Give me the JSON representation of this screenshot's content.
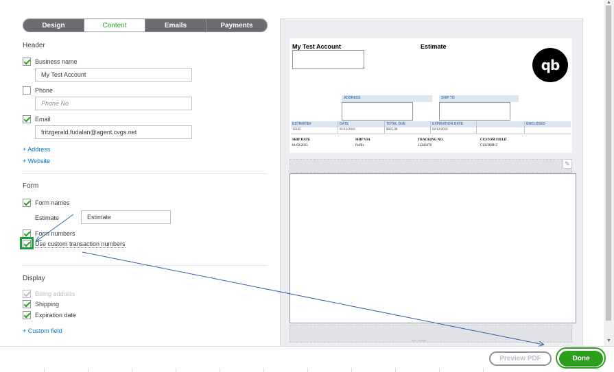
{
  "tabs": [
    "Design",
    "Content",
    "Emails",
    "Payments"
  ],
  "header_section": {
    "title": "Header",
    "business_name": {
      "label": "Business name",
      "value": "My Test Account"
    },
    "phone": {
      "label": "Phone",
      "placeholder": "Phone No"
    },
    "email": {
      "label": "Email",
      "value": "fritzgerald.fudalan@agent.cvgs.net"
    },
    "add_address": "+ Address",
    "add_website": "+ Website"
  },
  "form_section": {
    "title": "Form",
    "form_names_label": "Form names",
    "estimate_label": "Estimate",
    "estimate_value": "Estimate",
    "form_numbers_label": "Form numbers",
    "custom_numbers_label": "Use custom transaction numbers"
  },
  "display_section": {
    "title": "Display",
    "billing_label": "Billing address",
    "shipping_label": "Shipping",
    "expiration_label": "Expiration date",
    "add_custom_field": "+ Custom field"
  },
  "preview": {
    "company": "My Test Account",
    "doc_type": "Estimate",
    "logo_text": "qb",
    "address_label": "ADDRESS",
    "ship_to_label": "SHIP TO",
    "table_headers": [
      "ESTIMATE#",
      "DATE",
      "TOTAL DUE",
      "EXPIRATION DATE",
      "",
      "ENCLOSED"
    ],
    "table_values": [
      "12345",
      "01/12/2016",
      "$665.00",
      "02/12/2016",
      "",
      ""
    ],
    "ship_headers": [
      "SHIP DATE",
      "SHIP VIA",
      "TRACKING NO.",
      "CUSTOM FIELD"
    ],
    "ship_values": [
      "01/03/2015",
      "FedEx",
      "12345678",
      "CUSTOM-2"
    ],
    "footer_text": "Info / Image"
  },
  "buttons": {
    "preview_pdf": "Preview PDF",
    "done": "Done"
  },
  "colors": {
    "accent_green": "#2ca01c",
    "link_blue": "#0077c5",
    "annotation_blue": "#2e5fa8"
  },
  "icons": {
    "pencil": "pencil-icon",
    "checkmark": "checkmark-icon"
  }
}
